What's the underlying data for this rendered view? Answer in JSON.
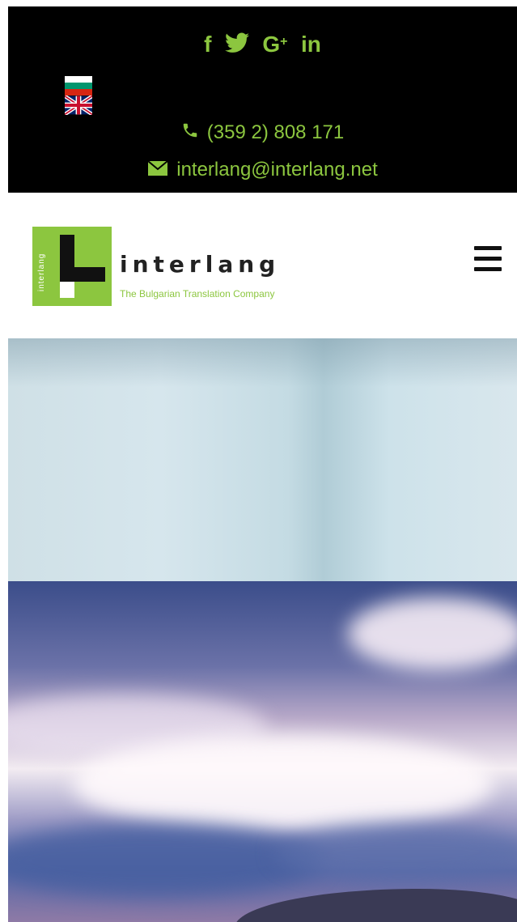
{
  "topbar": {
    "social": [
      {
        "name": "facebook",
        "glyph": "f"
      },
      {
        "name": "twitter",
        "glyph": "🐦"
      },
      {
        "name": "google-plus",
        "glyph": "G+"
      },
      {
        "name": "linkedin",
        "glyph": "in"
      }
    ],
    "phone": "(359 2) 808 171",
    "email": "interlang@interlang.net",
    "accent_color": "#8cc63f"
  },
  "header": {
    "logo_vertical_text": "interlang",
    "brand_name": "interlang",
    "tagline": "The Bulgarian Translation Company"
  }
}
